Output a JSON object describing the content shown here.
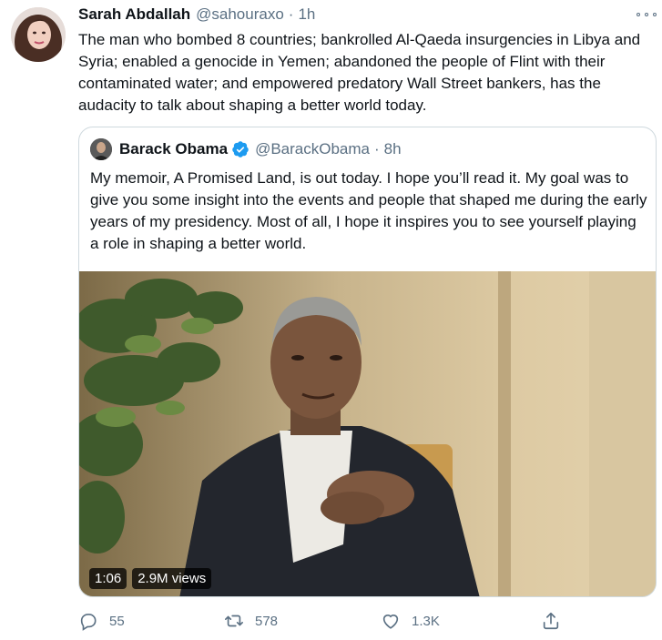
{
  "tweet": {
    "author_name": "Sarah Abdallah",
    "author_handle": "@sahouraxo",
    "separator": "·",
    "time": "1h",
    "text": "The man who bombed 8 countries; bankrolled Al-Qaeda insurgencies in Libya and Syria; enabled a genocide in Yemen; abandoned the people of Flint with their contaminated water; and empowered predatory Wall Street bankers, has the audacity to talk about shaping a better world today."
  },
  "quoted_tweet": {
    "author_name": "Barack Obama",
    "author_handle": "@BarackObama",
    "separator": "·",
    "time": "8h",
    "text": "My memoir, A Promised Land, is out today. I hope you’ll read it. My goal was to give you some insight into the events and people that shaped me during the early years of my presidency. Most of all, I hope it inspires you to see yourself playing a role in shaping a better world.",
    "video": {
      "duration": "1:06",
      "views": "2.9M views"
    }
  },
  "actions": {
    "replies": "55",
    "retweets": "578",
    "likes": "1.3K"
  },
  "colors": {
    "text": "#0f1419",
    "muted": "#5b7083",
    "border": "#cfd9de",
    "verified": "#1d9bf0"
  },
  "icons": [
    "more-icon",
    "verified-icon",
    "reply-icon",
    "retweet-icon",
    "like-icon",
    "share-icon"
  ]
}
